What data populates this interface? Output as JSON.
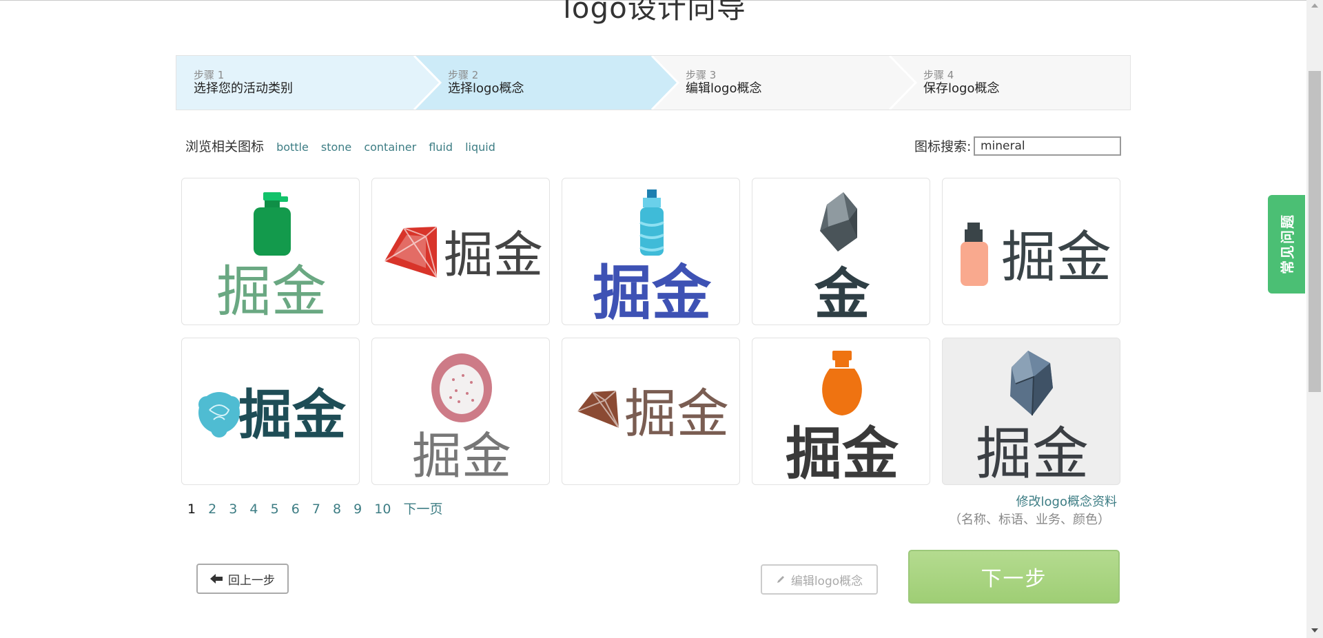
{
  "page": {
    "title": "logo设计向导"
  },
  "steps": [
    {
      "num": "步骤 1",
      "label": "选择您的活动类别",
      "state": "done"
    },
    {
      "num": "步骤 2",
      "label": "选择logo概念",
      "state": "active"
    },
    {
      "num": "步骤 3",
      "label": "编辑logo概念",
      "state": "todo"
    },
    {
      "num": "步骤 4",
      "label": "保存logo概念",
      "state": "todo"
    }
  ],
  "related": {
    "label": "浏览相关图标",
    "tags": [
      "bottle",
      "stone",
      "container",
      "fluid",
      "liquid"
    ]
  },
  "search": {
    "label": "图标搜索:",
    "value": "mineral"
  },
  "logos": [
    {
      "icon": "pump-bottle-icon",
      "text": "掘金",
      "icon_color": "#139a4c",
      "text_color": "#6aa882"
    },
    {
      "icon": "red-gem-icon",
      "text": "掘金",
      "icon_color": "#d8342a",
      "text_color": "#444444"
    },
    {
      "icon": "water-bottle-icon",
      "text": "掘金",
      "icon_color": "#3fbbd8",
      "text_color": "#3e52b4"
    },
    {
      "icon": "grey-rock-icon",
      "text": "金",
      "icon_color": "#4f5a60",
      "text_color": "#2f3f45"
    },
    {
      "icon": "peach-pump-bottle-icon",
      "text": "掘金",
      "icon_color": "#f9a98e",
      "text_color": "#3a4448"
    },
    {
      "icon": "blue-flower-icon",
      "text": "掘金",
      "icon_color": "#4fbcd2",
      "text_color": "#1e4d56"
    },
    {
      "icon": "dragon-fruit-icon",
      "text": "掘金",
      "icon_color": "#cd7b87",
      "text_color": "#777777"
    },
    {
      "icon": "brown-gem-icon",
      "text": "掘金",
      "icon_color": "#8b4a33",
      "text_color": "#7a5d52"
    },
    {
      "icon": "orange-jar-icon",
      "text": "掘金",
      "icon_color": "#ef7311",
      "text_color": "#3a3a3a"
    },
    {
      "icon": "blue-grey-rock-icon",
      "text": "掘金",
      "icon_color": "#5a7189",
      "text_color": "#3b3f44"
    }
  ],
  "pagination": {
    "pages": [
      "1",
      "2",
      "3",
      "4",
      "5",
      "6",
      "7",
      "8",
      "9",
      "10"
    ],
    "current": "1",
    "next": "下一页"
  },
  "edit_link": {
    "label": "修改logo概念资料",
    "hint": "（名称、标语、业务、颜色）"
  },
  "buttons": {
    "back": "回上一步",
    "edit": "编辑logo概念",
    "next": "下一步"
  },
  "faq": {
    "label": "常见问题"
  },
  "colors": {
    "accent": "#3d7d84",
    "step_done": "#e3f3fb",
    "step_active": "#cdebf8",
    "next_button": "#a9d585",
    "faq": "#4bbf74"
  }
}
